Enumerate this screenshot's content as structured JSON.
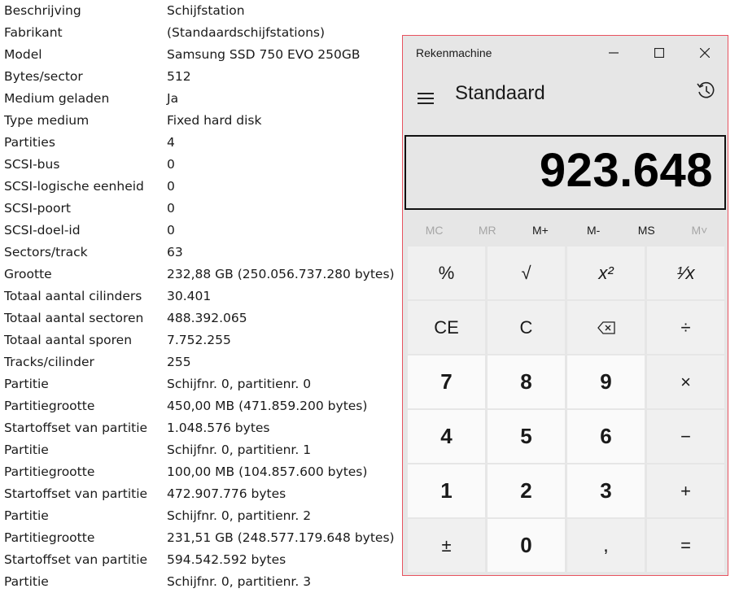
{
  "info_rows": [
    {
      "key": "Beschrijving",
      "value": "Schijfstation"
    },
    {
      "key": "Fabrikant",
      "value": "(Standaardschijfstations)"
    },
    {
      "key": "Model",
      "value": "Samsung SSD 750 EVO 250GB"
    },
    {
      "key": "Bytes/sector",
      "value": "512"
    },
    {
      "key": "Medium geladen",
      "value": "Ja"
    },
    {
      "key": "Type medium",
      "value": "Fixed hard disk"
    },
    {
      "key": "Partities",
      "value": "4"
    },
    {
      "key": "SCSI-bus",
      "value": "0"
    },
    {
      "key": "SCSI-logische eenheid",
      "value": "0"
    },
    {
      "key": "SCSI-poort",
      "value": "0"
    },
    {
      "key": "SCSI-doel-id",
      "value": "0"
    },
    {
      "key": "Sectors/track",
      "value": "63"
    },
    {
      "key": "Grootte",
      "value": "232,88 GB (250.056.737.280 bytes)"
    },
    {
      "key": "Totaal aantal cilinders",
      "value": "30.401"
    },
    {
      "key": "Totaal aantal sectoren",
      "value": "488.392.065"
    },
    {
      "key": "Totaal aantal sporen",
      "value": "7.752.255"
    },
    {
      "key": "Tracks/cilinder",
      "value": "255"
    },
    {
      "key": "Partitie",
      "value": "Schijfnr. 0, partitienr. 0"
    },
    {
      "key": "Partitiegrootte",
      "value": "450,00 MB (471.859.200 bytes)"
    },
    {
      "key": "Startoffset van partitie",
      "value": "1.048.576 bytes"
    },
    {
      "key": "Partitie",
      "value": "Schijfnr. 0, partitienr. 1"
    },
    {
      "key": "Partitiegrootte",
      "value": "100,00 MB (104.857.600 bytes)"
    },
    {
      "key": "Startoffset van partitie",
      "value": "472.907.776 bytes"
    },
    {
      "key": "Partitie",
      "value": "Schijfnr. 0, partitienr. 2"
    },
    {
      "key": "Partitiegrootte",
      "value": "231,51 GB (248.577.179.648 bytes)"
    },
    {
      "key": "Startoffset van partitie",
      "value": "594.542.592 bytes"
    },
    {
      "key": "Partitie",
      "value": "Schijfnr. 0, partitienr. 3"
    }
  ],
  "calculator": {
    "title": "Rekenmachine",
    "mode": "Standaard",
    "display": "923.648",
    "memory": [
      {
        "label": "MC",
        "enabled": false
      },
      {
        "label": "MR",
        "enabled": false
      },
      {
        "label": "M+",
        "enabled": true
      },
      {
        "label": "M-",
        "enabled": true
      },
      {
        "label": "MS",
        "enabled": true
      },
      {
        "label": "M˅",
        "enabled": false
      }
    ],
    "keys": [
      [
        "%",
        "√",
        "x²",
        "¹⁄x"
      ],
      [
        "CE",
        "C",
        "backspace",
        "÷"
      ],
      [
        "7",
        "8",
        "9",
        "×"
      ],
      [
        "4",
        "5",
        "6",
        "−"
      ],
      [
        "1",
        "2",
        "3",
        "+"
      ],
      [
        "±",
        "0",
        ",",
        "="
      ]
    ]
  },
  "colors": {
    "window_border": "#e8525f",
    "keypad_bg": "#e6e6e6",
    "digit_key": "#fafafa",
    "op_key": "#f0f0f0"
  }
}
